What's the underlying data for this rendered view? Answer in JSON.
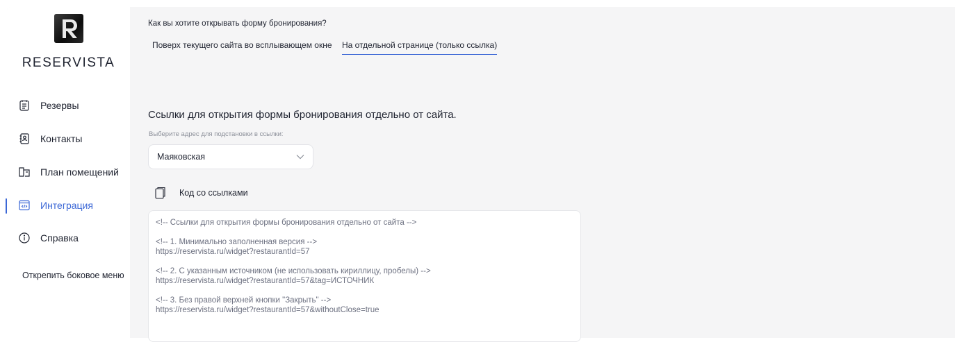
{
  "brand": {
    "name": "RESERVISTA"
  },
  "sidebar": {
    "items": [
      {
        "label": "Резервы",
        "icon": "reservations-icon"
      },
      {
        "label": "Контакты",
        "icon": "contacts-icon"
      },
      {
        "label": "План помещений",
        "icon": "floor-plan-icon"
      },
      {
        "label": "Интеграция",
        "icon": "integration-icon",
        "active": true
      },
      {
        "label": "Справка",
        "icon": "info-icon"
      }
    ],
    "unpin_label": "Открепить боковое меню"
  },
  "main": {
    "question": "Как вы хотите открывать форму бронирования?",
    "tabs": [
      {
        "label": "Поверх текущего сайта во всплывающем окне",
        "selected": false
      },
      {
        "label": "На отдельной странице (только ссылка)",
        "selected": true
      }
    ],
    "section_title": "Ссылки для открытия формы бронирования отдельно от сайта.",
    "address_hint": "Выберите адрес для подстановки в ссылки:",
    "address_select": {
      "value": "Маяковская"
    },
    "code_header": "Код со ссылками",
    "code_lines": {
      "comment_main": "<!-- Ссылки для открытия формы бронирования отдельно от сайта -->",
      "comment_1": "<!-- 1. Минимально заполненная версия -->",
      "url_1": "https://reservista.ru/widget?restaurantId=57",
      "comment_2": "<!-- 2. С указанным источником (не использовать кириллицу, пробелы) -->",
      "url_2": "https://reservista.ru/widget?restaurantId=57&tag=ИСТОЧНИК",
      "comment_3": "<!-- 3. Без правой верхней кнопки \"Закрыть\" -->",
      "url_3": "https://reservista.ru/widget?restaurantId=57&withoutClose=true"
    }
  },
  "colors": {
    "accent": "#3b67d6",
    "background": "#f5f5f6",
    "text": "#1f2330",
    "muted": "#6c7080"
  }
}
